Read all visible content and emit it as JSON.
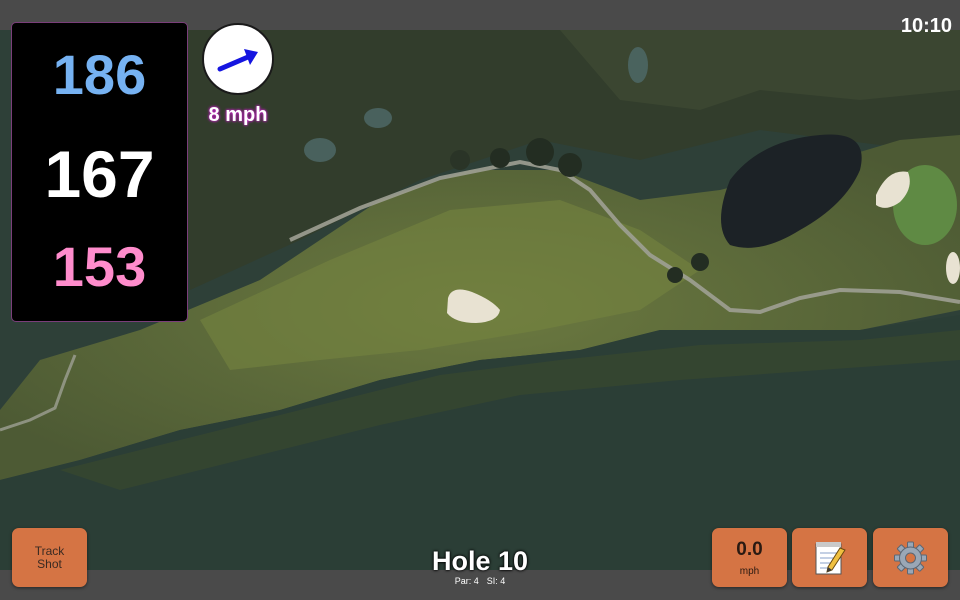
{
  "status": {
    "time": "10:10"
  },
  "distances": {
    "back": "186",
    "center": "167",
    "front": "153"
  },
  "wind": {
    "speed": "8 mph",
    "icon": "wind-direction-arrow-icon"
  },
  "hole": {
    "title": "Hole 10",
    "par": "Par: 4",
    "stroke_index": "SI: 4"
  },
  "buttons": {
    "track_shot": {
      "line1": "Track",
      "line2": "Shot"
    },
    "speed": {
      "value": "0.0",
      "unit": "mph"
    },
    "notes": {
      "icon": "memo-icon"
    },
    "settings": {
      "icon": "gear-icon"
    }
  },
  "colors": {
    "back_distance": "#76b2f2",
    "center_distance": "#ffffff",
    "front_distance": "#ff8ccc",
    "button": "#d57444",
    "panel_border": "#7a3e7a"
  }
}
